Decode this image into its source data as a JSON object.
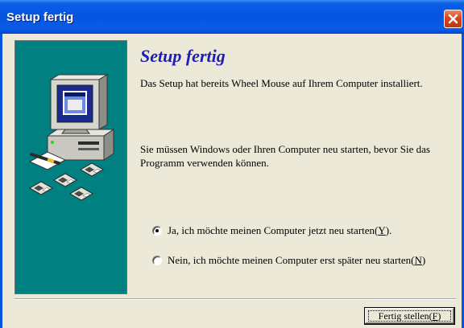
{
  "window": {
    "title": "Setup fertig",
    "close_icon": "close-icon"
  },
  "colors": {
    "titlebar": "#0554E0",
    "client": "#ECE9D8",
    "panel": "#008080",
    "heading": "#1E1EB4",
    "close_button": "#D9441A"
  },
  "illustration": {
    "icons": [
      "computer-icon",
      "monitor-icon",
      "pen-icon",
      "floppy-disk-icon"
    ]
  },
  "main": {
    "heading": "Setup fertig",
    "installed_text": "Das Setup hat bereits Wheel Mouse auf Ihrem Computer installiert.",
    "restart_text_line1": "Sie müssen Windows oder Ihren Computer neu starten, bevor Sie das",
    "restart_text_line2": "Programm verwenden können."
  },
  "options": [
    {
      "prefix": "Ja, ich möchte meinen Computer jetzt neu starten(",
      "accel": "Y",
      "suffix": ").",
      "checked": true
    },
    {
      "prefix": "Nein, ich möchte meinen Computer erst später neu starten(",
      "accel": "N",
      "suffix": ")",
      "checked": false
    }
  ],
  "footer": {
    "finish_prefix": "Fertig stellen(",
    "finish_accel": "F",
    "finish_suffix": ")"
  }
}
